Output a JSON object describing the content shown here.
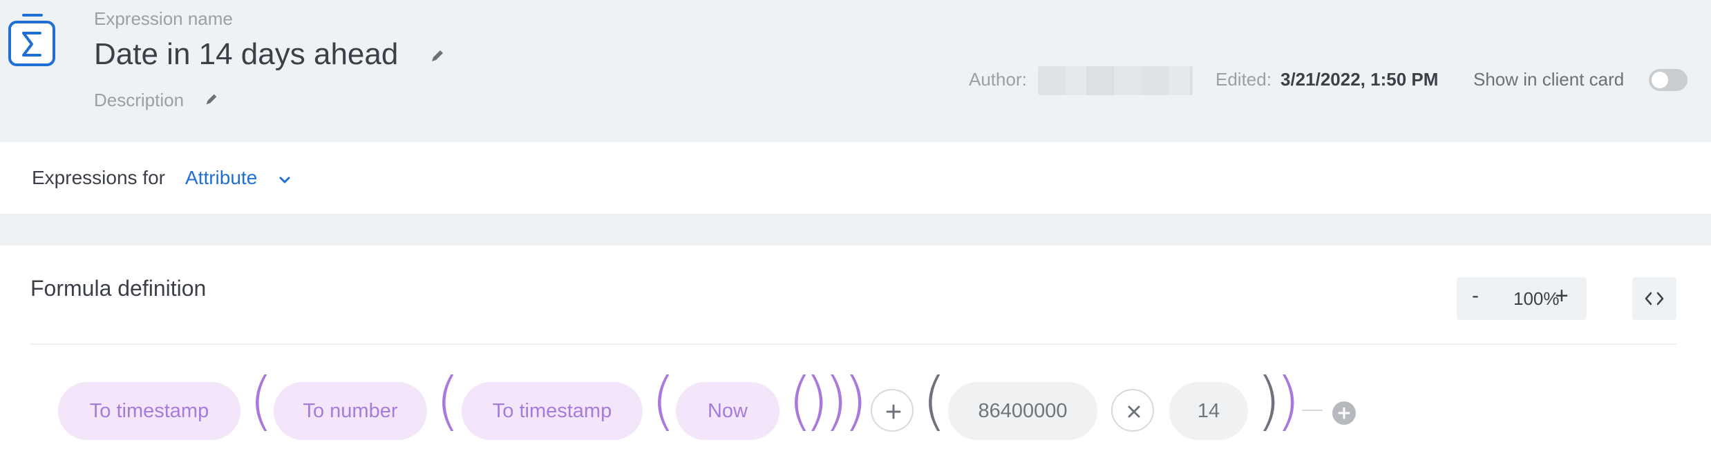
{
  "header": {
    "expression_name_label": "Expression name",
    "title": "Date in 14 days ahead",
    "description_label": "Description",
    "author_label": "Author:",
    "edited_label": "Edited:",
    "edited_value": "3/21/2022, 1:50 PM",
    "show_in_client_card_label": "Show in client card",
    "show_in_client_card_enabled": false
  },
  "expressions_bar": {
    "label": "Expressions for",
    "selected": "Attribute"
  },
  "formula": {
    "title": "Formula definition",
    "zoom_minus": "-",
    "zoom_value": "100%",
    "zoom_plus": "+",
    "nodes": {
      "to_timestamp_1": "To timestamp",
      "to_number": "To number",
      "to_timestamp_2": "To timestamp",
      "now": "Now",
      "value_ms": "86400000",
      "value_days": "14"
    },
    "parens": {
      "open": "(",
      "close": ")"
    }
  },
  "colors": {
    "accent_blue": "#1f6fd6",
    "function_pill_bg": "#f3e6fb",
    "function_pill_text": "#a57cd9",
    "paren_purple": "#a978dd",
    "paren_gray": "#6e737b"
  },
  "icons": [
    "sigma-icon",
    "pencil-icon",
    "chevron-down-icon",
    "code-icon",
    "plus-icon",
    "multiply-icon",
    "add-circle-icon"
  ]
}
